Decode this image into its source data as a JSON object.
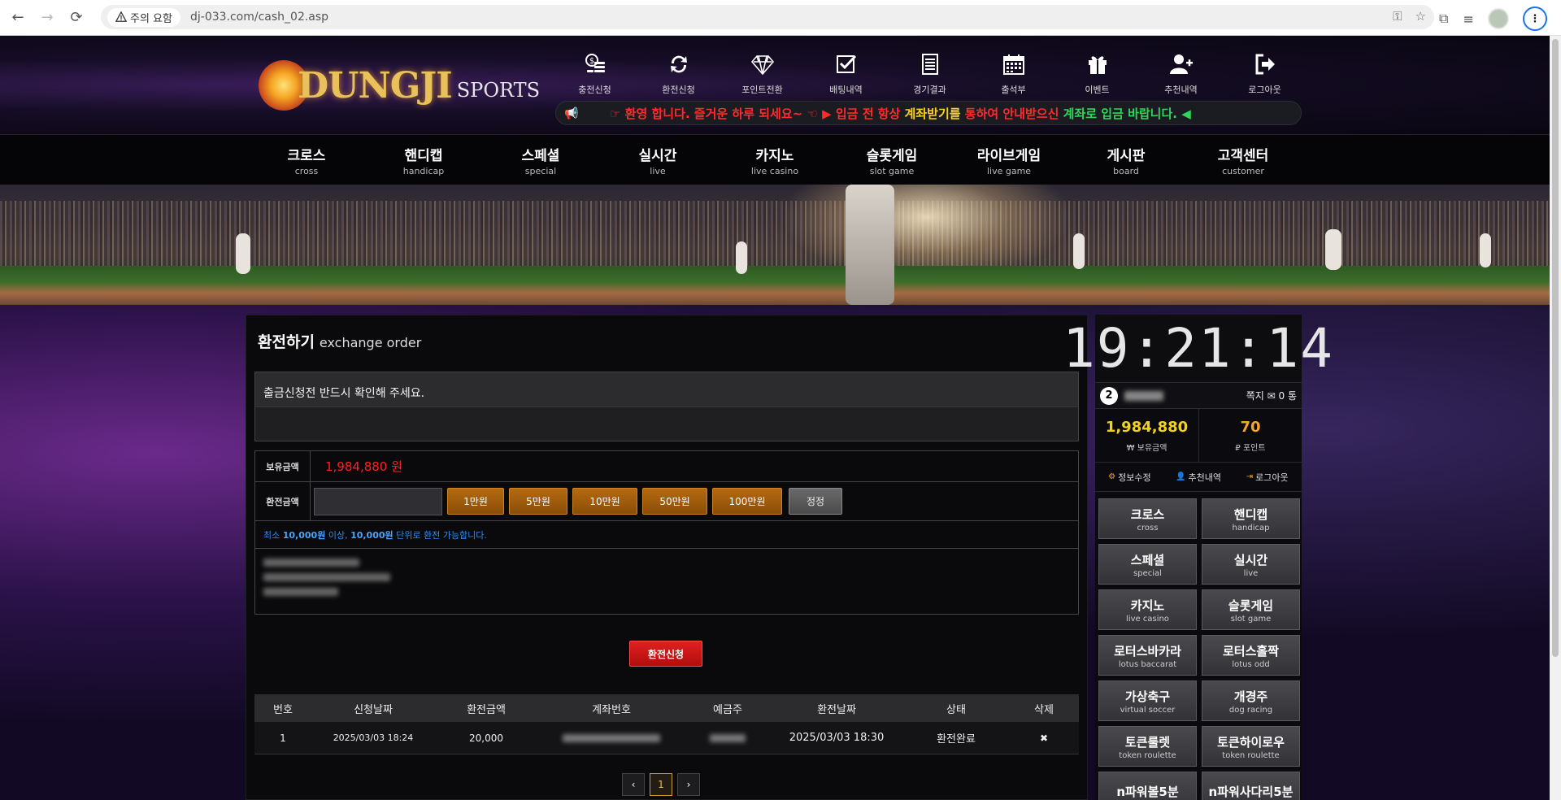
{
  "browser": {
    "warning_label": "주의 요함",
    "url": "dj-033.com/cash_02.asp"
  },
  "logo": {
    "main": "DUNGJI",
    "sub": "SPORTS"
  },
  "topnav": [
    {
      "label": "충전신청",
      "icon": "coin-stack-icon"
    },
    {
      "label": "환전신청",
      "icon": "refresh-icon"
    },
    {
      "label": "포인트전환",
      "icon": "diamond-icon"
    },
    {
      "label": "배팅내역",
      "icon": "checkbox-icon"
    },
    {
      "label": "경기결과",
      "icon": "document-icon"
    },
    {
      "label": "출석부",
      "icon": "calendar-icon"
    },
    {
      "label": "이벤트",
      "icon": "gift-icon"
    },
    {
      "label": "추천내역",
      "icon": "add-user-icon"
    },
    {
      "label": "로그아웃",
      "icon": "logout-icon"
    }
  ],
  "marquee": {
    "part1": "☞ 환영 합니다. 즐거운 하루 되세요~ ☜ ▶ 입금 전 항상 ",
    "part2": "계좌받기를",
    "part3": " 통하여 안내받으신 ",
    "part4": "계좌로 입금 바랍니다. ◀"
  },
  "mainnav": [
    {
      "ko": "크로스",
      "en": "cross"
    },
    {
      "ko": "핸디캡",
      "en": "handicap"
    },
    {
      "ko": "스페셜",
      "en": "special"
    },
    {
      "ko": "실시간",
      "en": "live"
    },
    {
      "ko": "카지노",
      "en": "live casino"
    },
    {
      "ko": "슬롯게임",
      "en": "slot game"
    },
    {
      "ko": "라이브게임",
      "en": "live game"
    },
    {
      "ko": "게시판",
      "en": "board"
    },
    {
      "ko": "고객센터",
      "en": "customer"
    }
  ],
  "page": {
    "title_ko": "환전하기",
    "title_en": "exchange order",
    "notice": "출금신청전 반드시 확인해 주세요."
  },
  "form": {
    "balance_label": "보유금액",
    "balance_value": "1,984,880 원",
    "amount_label": "환전금액",
    "amount_value": "",
    "buttons": [
      "1만원",
      "5만원",
      "10만원",
      "50만원",
      "100만원"
    ],
    "reset_label": "정정",
    "hint_1": "최소 ",
    "hint_b1": "10,000원",
    "hint_2": " 이상, ",
    "hint_b2": "10,000원",
    "hint_3": "  단위로 환전 가능합니다.",
    "submit_label": "환전신청"
  },
  "table": {
    "headers": [
      "번호",
      "신청날짜",
      "환전금액",
      "계좌번호",
      "예금주",
      "환전날짜",
      "상태",
      "삭제"
    ],
    "rows": [
      {
        "no": "1",
        "req_date": "2025/03/03 18:24",
        "amount": "20,000",
        "done_date": "2025/03/03 18:30",
        "status": "환전완료",
        "delete": "✖"
      }
    ]
  },
  "pager": {
    "prev": "‹",
    "current": "1",
    "next": "›"
  },
  "sidebar": {
    "clock": "19:21:14",
    "level": "2",
    "message_label": "쪽지",
    "message_count": "0 통",
    "balance": "1,984,880",
    "balance_label": "₩ 보유금액",
    "points": "70",
    "points_label": "₽ 포인트",
    "links": [
      {
        "icon": "gear-icon",
        "label": "정보수정"
      },
      {
        "icon": "user-icon",
        "label": "추천내역"
      },
      {
        "icon": "logout-icon",
        "label": "로그아웃"
      }
    ],
    "games": [
      {
        "ko": "크로스",
        "en": "cross"
      },
      {
        "ko": "핸디캡",
        "en": "handicap"
      },
      {
        "ko": "스페셜",
        "en": "special"
      },
      {
        "ko": "실시간",
        "en": "live"
      },
      {
        "ko": "카지노",
        "en": "live casino"
      },
      {
        "ko": "슬롯게임",
        "en": "slot game"
      },
      {
        "ko": "로터스바카라",
        "en": "lotus baccarat"
      },
      {
        "ko": "로터스홀짝",
        "en": "lotus odd"
      },
      {
        "ko": "가상축구",
        "en": "virtual soccer"
      },
      {
        "ko": "개경주",
        "en": "dog racing"
      },
      {
        "ko": "토큰룰렛",
        "en": "token roulette"
      },
      {
        "ko": "토큰하이로우",
        "en": "token roulette"
      },
      {
        "ko": "n파워볼5분",
        "en": ""
      },
      {
        "ko": "n파워사다리5분",
        "en": ""
      }
    ]
  }
}
